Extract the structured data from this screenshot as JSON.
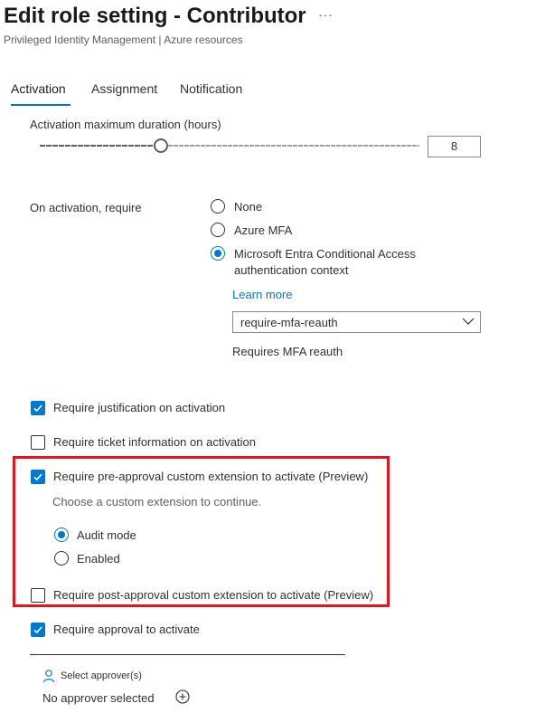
{
  "header": {
    "title": "Edit role setting - Contributor",
    "more_label": "···",
    "subtitle": "Privileged Identity Management | Azure resources"
  },
  "tabs": [
    {
      "label": "Activation",
      "active": true
    },
    {
      "label": "Assignment",
      "active": false
    },
    {
      "label": "Notification",
      "active": false
    }
  ],
  "activation": {
    "max_duration_label": "Activation maximum duration (hours)",
    "max_duration_value": "8",
    "slider_fraction": 0.32,
    "require_label": "On activation, require",
    "require_options": [
      {
        "label": "None",
        "selected": false
      },
      {
        "label": "Azure MFA",
        "selected": false
      },
      {
        "label_line1": "Microsoft Entra Conditional Access",
        "label_line2": "authentication context",
        "selected": true
      }
    ],
    "learn_more": "Learn more",
    "auth_context_value": "require-mfa-reauth",
    "auth_context_description": "Requires MFA reauth",
    "checkboxes": {
      "justification": {
        "label": "Require justification on activation",
        "checked": true
      },
      "ticket": {
        "label": "Require ticket information on activation",
        "checked": false
      },
      "pre_approval": {
        "label": "Require pre-approval custom extension to activate (Preview)",
        "checked": true
      },
      "post_approval": {
        "label": "Require post-approval custom extension to activate (Preview)",
        "checked": false
      },
      "approval": {
        "label": "Require approval to activate",
        "checked": true
      }
    },
    "custom_extension_hint": "Choose a custom extension to continue.",
    "mode_options": [
      {
        "label": "Audit mode",
        "selected": true
      },
      {
        "label": "Enabled",
        "selected": false
      }
    ],
    "select_approvers": "Select approver(s)",
    "no_approver": "No approver selected"
  },
  "colors": {
    "accent": "#0078d4",
    "highlight_border": "#e8131a",
    "text": "#323130"
  }
}
